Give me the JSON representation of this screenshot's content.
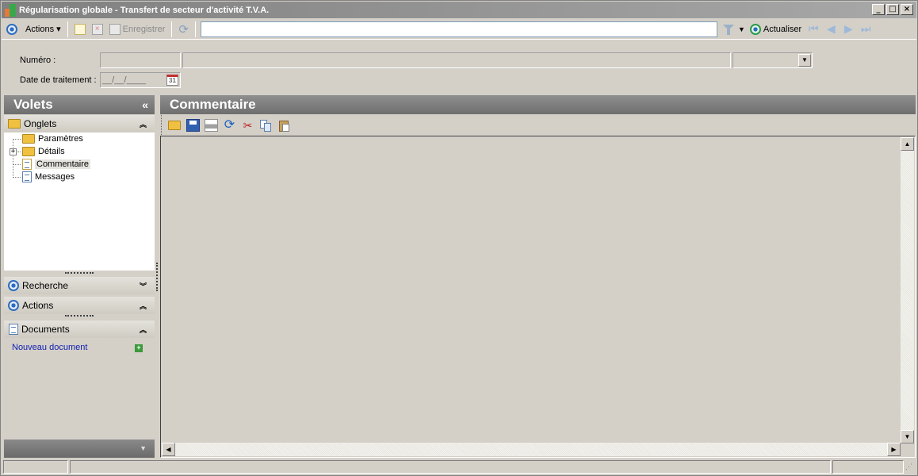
{
  "window": {
    "title": "Régularisation globale - Transfert de secteur d'activité T.V.A.",
    "controls": [
      "minimize",
      "maximize",
      "close"
    ]
  },
  "toolbar": {
    "actions_label": "Actions",
    "save_label": "Enregistrer",
    "search_value": "",
    "refresh_label": "Actualiser"
  },
  "form": {
    "numero_label": "Numéro :",
    "date_label": "Date de traitement :",
    "date_placeholder": "__/__/____",
    "calendar_day": "31"
  },
  "left_pane": {
    "title": "Volets",
    "collapse_glyph": "«",
    "onglets": {
      "label": "Onglets",
      "items": [
        {
          "label": "Paramètres",
          "icon": "folder-icon"
        },
        {
          "label": "Détails",
          "icon": "folder-icon"
        },
        {
          "label": "Commentaire",
          "icon": "document-icon",
          "selected": true
        },
        {
          "label": "Messages",
          "icon": "document-icon"
        }
      ]
    },
    "recherche_label": "Recherche",
    "actions_label": "Actions",
    "documents": {
      "label": "Documents",
      "new_document": "Nouveau document"
    }
  },
  "right_pane": {
    "title": "Commentaire"
  }
}
